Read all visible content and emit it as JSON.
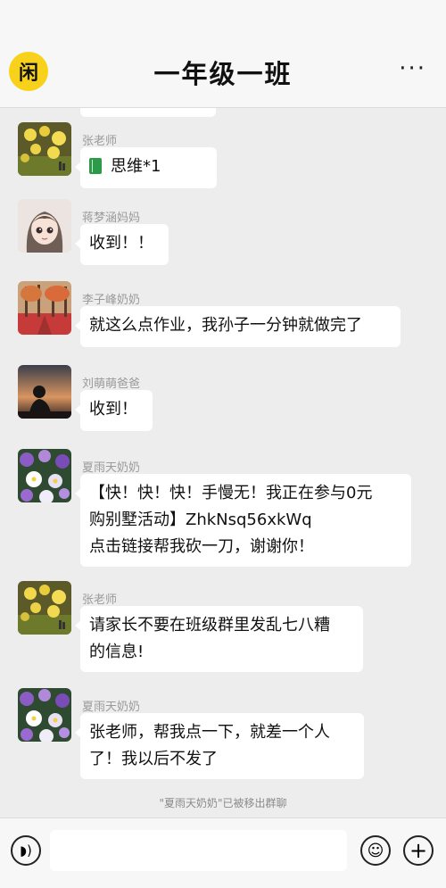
{
  "header": {
    "logo_text": "闲",
    "title": "一年级一班",
    "more_label": "···"
  },
  "messages": [
    {
      "sender": "张老师",
      "text": "思维*1",
      "avatar": "yellow-flowers",
      "attachment_icon": "book-icon"
    },
    {
      "sender": "蒋梦涵妈妈",
      "text": "收到！！",
      "avatar": "anime-girl"
    },
    {
      "sender": "李子峰奶奶",
      "text": "就这么点作业，我孙子一分钟就做完了",
      "avatar": "autumn-trees"
    },
    {
      "sender": "刘萌萌爸爸",
      "text": "收到！",
      "avatar": "sunset-silhouette"
    },
    {
      "sender": "夏雨天奶奶",
      "text": "【快！快！快！手慢无！我正在参与0元\n购别墅活动】ZhkNsq56xkWq\n点击链接帮我砍一刀，谢谢你！",
      "avatar": "purple-flowers"
    },
    {
      "sender": "张老师",
      "text": "请家长不要在班级群里发乱七八糟\n的信息!",
      "avatar": "yellow-flowers"
    },
    {
      "sender": "夏雨天奶奶",
      "text": "张老师，帮我点一下，就差一个人\n了！我以后不发了",
      "avatar": "purple-flowers"
    }
  ],
  "system_notice": "\"夏雨天奶奶\"已被移出群聊",
  "input_bar": {
    "voice_icon": "voice-icon",
    "emoji_icon": "emoji-icon",
    "plus_icon": "plus-icon",
    "voice_glyph": "◗)",
    "emoji_glyph": "☺",
    "plus_glyph": "+"
  }
}
